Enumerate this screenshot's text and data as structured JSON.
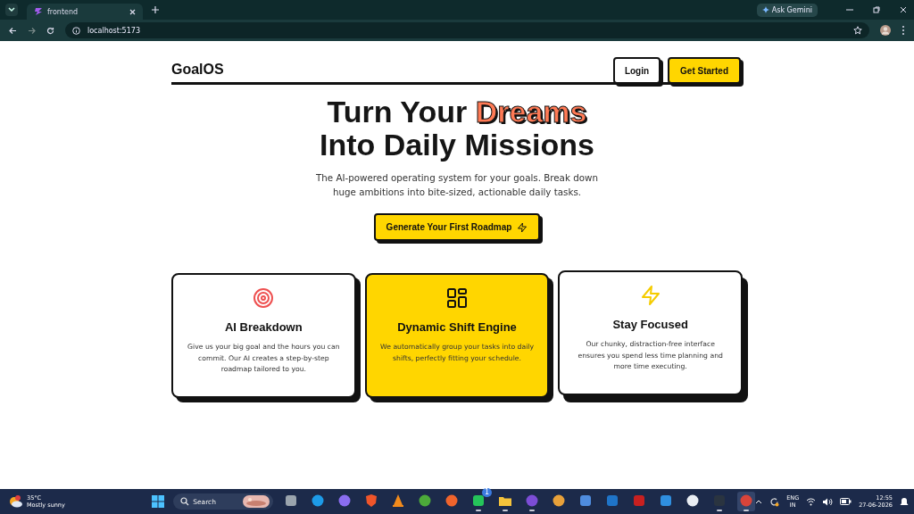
{
  "browser": {
    "tab": {
      "title": "frontend",
      "selected": true
    },
    "gemini_button": "Ask Gemini",
    "url": "localhost:5173"
  },
  "header": {
    "logo": "GoalOS",
    "buttons": [
      {
        "label": "Login",
        "kind": "outline"
      },
      {
        "label": "Get Started",
        "kind": "primary"
      }
    ]
  },
  "hero": {
    "line1": "Turn Your",
    "accent": "Dreams",
    "line2": "Into Daily Missions",
    "subtitle": "The AI-powered operating system for your goals. Break down huge ambitions into bite-sized, actionable daily tasks.",
    "cta": "Generate Your First Roadmap"
  },
  "features": [
    {
      "kind": "target",
      "title": "AI Breakdown",
      "text": "Give us your big goal and the hours you can commit. Our AI creates a step-by-step roadmap tailored to you.",
      "highlighted": false,
      "raised": false
    },
    {
      "kind": "grid",
      "title": "Dynamic Shift Engine",
      "text": "We automatically group your tasks into daily shifts, perfectly fitting your schedule.",
      "highlighted": true,
      "raised": false
    },
    {
      "kind": "bolt",
      "title": "Stay Focused",
      "text": "Our chunky, distraction-free interface ensures you spend less time planning and more time executing.",
      "highlighted": false,
      "raised": true
    }
  ],
  "taskbar": {
    "weather": {
      "temp": "35°C",
      "condition": "Mostly sunny"
    },
    "search": {
      "placeholder": "Search"
    },
    "apps": [
      {
        "kind": "square",
        "color": "#9aa4ad",
        "running": false,
        "active": false
      },
      {
        "kind": "circle",
        "color": "#1d9be8",
        "running": false,
        "active": false
      },
      {
        "kind": "circle",
        "color": "#8a6df0",
        "running": false,
        "active": false
      },
      {
        "kind": "shield",
        "color": "#f0552a",
        "running": false,
        "active": false
      },
      {
        "kind": "cone",
        "color": "#f28b1c",
        "running": false,
        "active": false
      },
      {
        "kind": "circle",
        "color": "#4caa3a",
        "running": false,
        "active": false
      },
      {
        "kind": "circle",
        "color": "#f0642c",
        "running": false,
        "active": false
      },
      {
        "kind": "square",
        "color": "#25c45a",
        "running": true,
        "active": false,
        "badge": "1"
      },
      {
        "kind": "folder",
        "color": "#f5c33b",
        "running": true,
        "active": false
      },
      {
        "kind": "circle",
        "color": "#7c4dd6",
        "running": true,
        "active": false
      },
      {
        "kind": "circle",
        "color": "#e8a13a",
        "running": false,
        "active": false
      },
      {
        "kind": "square",
        "color": "#4f8de0",
        "running": false,
        "active": false
      },
      {
        "kind": "square",
        "color": "#1f74c8",
        "running": false,
        "active": false
      },
      {
        "kind": "square",
        "color": "#c82020",
        "running": false,
        "active": false
      },
      {
        "kind": "square",
        "color": "#2f8fe0",
        "running": false,
        "active": false
      },
      {
        "kind": "circle",
        "color": "#e9eef4",
        "running": false,
        "active": false
      },
      {
        "kind": "square",
        "color": "#2a3440",
        "running": true,
        "active": false
      },
      {
        "kind": "circle",
        "color": "#d9443a",
        "running": true,
        "active": true
      }
    ],
    "language": "ENG",
    "region": "IN",
    "time": "12:55",
    "date": "27-06-2026"
  }
}
